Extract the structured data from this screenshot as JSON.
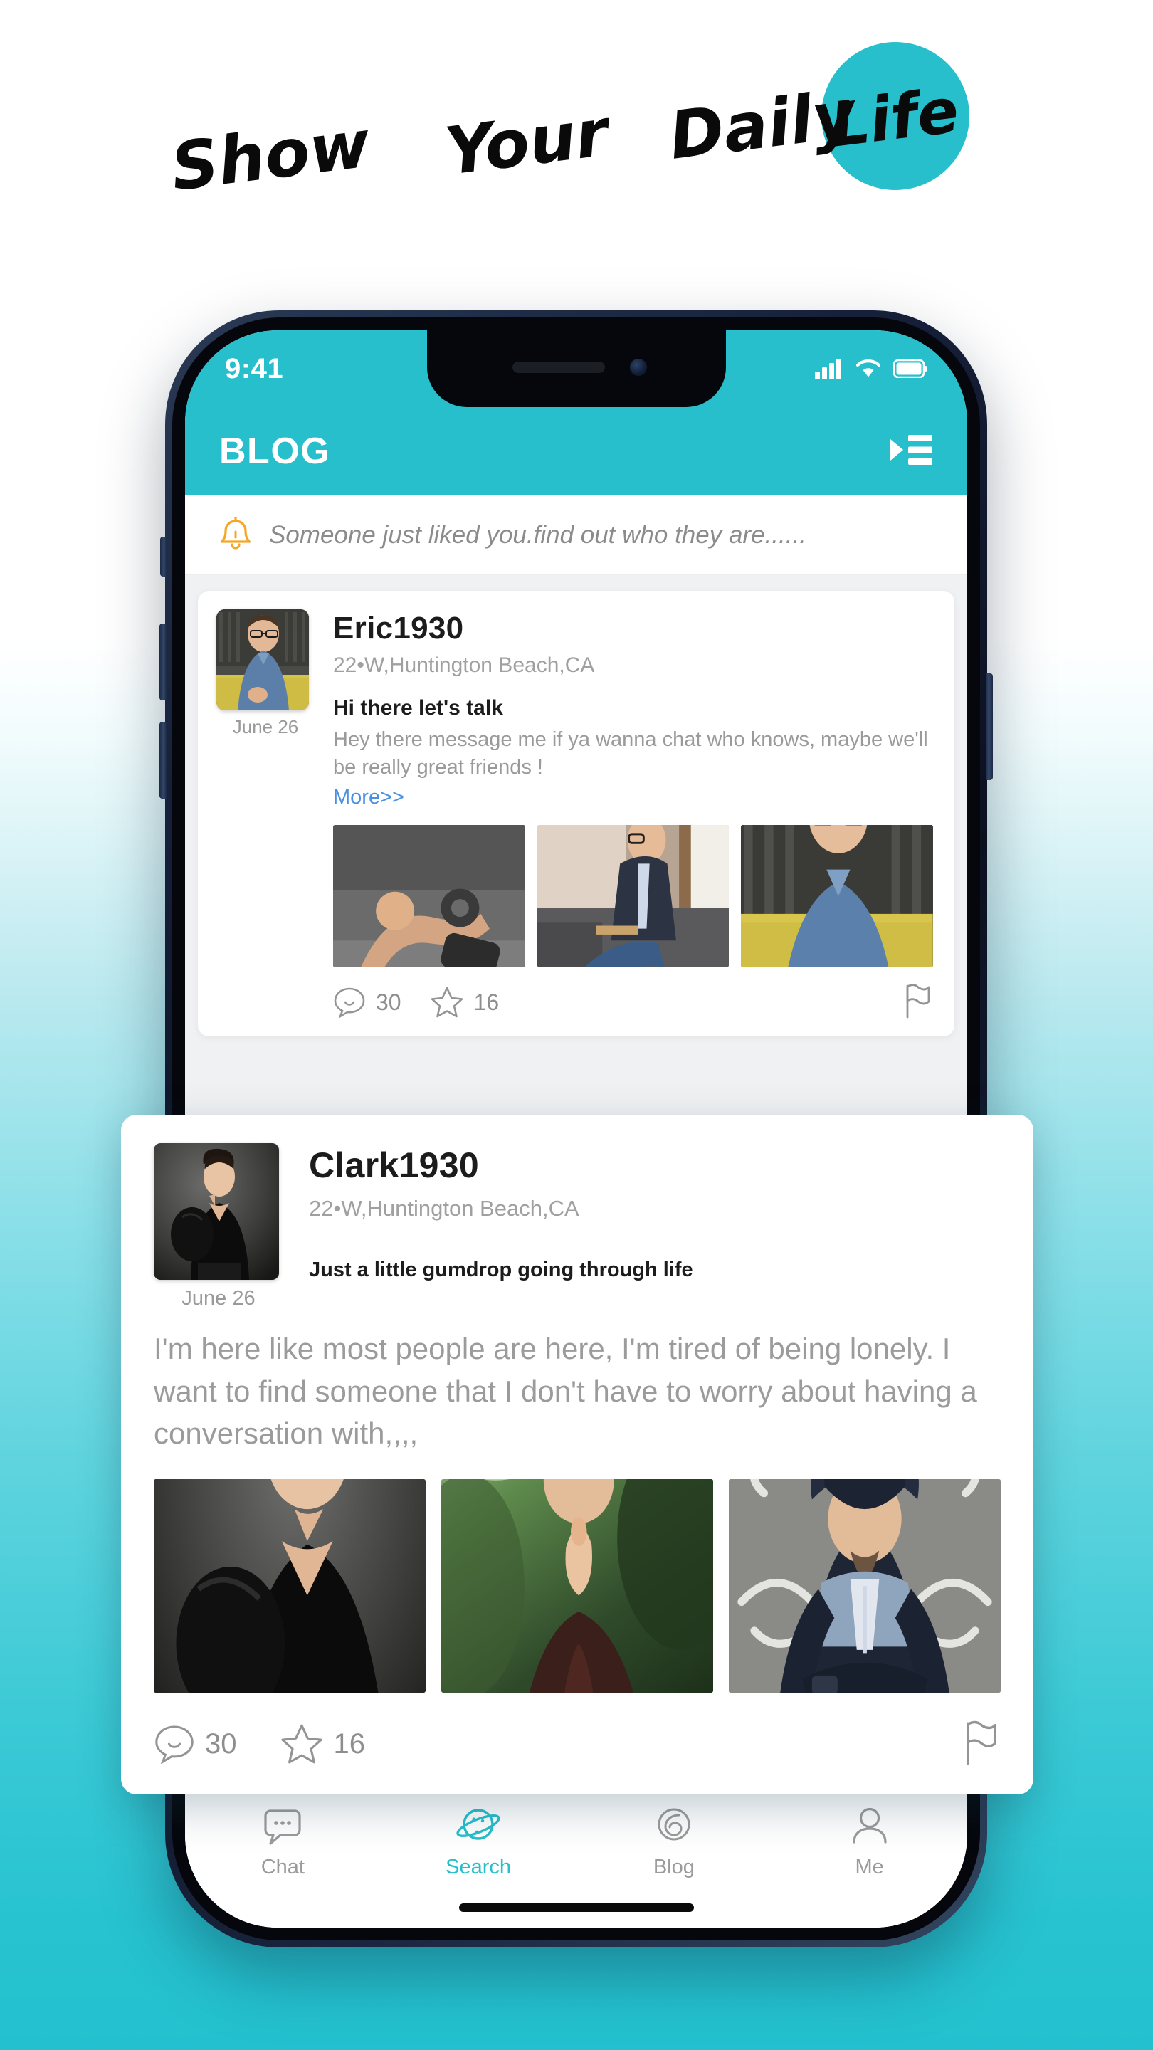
{
  "headline": {
    "words": [
      "Show",
      "Your",
      "Daily"
    ],
    "badge_word": "Life",
    "badge_color": "#27bfcc",
    "text_color": "#0a0a0a"
  },
  "theme": {
    "accent": "#27bfcc",
    "link": "#4a90e2",
    "bell": "#f5a623",
    "muted_text": "#9a9a9a",
    "page_bg_top": "#ffffff",
    "page_bg_bottom": "#23c1cf"
  },
  "phone": {
    "status_bar": {
      "time": "9:41",
      "signal_icon": "cellular-signal-icon",
      "wifi_icon": "wifi-icon",
      "battery_icon": "battery-icon"
    },
    "app_bar": {
      "title": "BLOG",
      "menu_icon": "indent-menu-icon"
    },
    "notification": {
      "icon": "bell-icon",
      "text": "Someone just liked you.find out who they are......"
    },
    "feed": {
      "posts": [
        {
          "username": "Eric1930",
          "meta": "22•W,Huntington Beach,CA",
          "date": "June 26",
          "headline": "Hi there let's talk",
          "body": "Hey there message me if ya wanna chat who knows, maybe we'll be really great friends !",
          "more_label": "More>>",
          "avatar_alt": "man-in-blue-shirt-glasses-avatar",
          "photos": [
            "man-doing-pushups-with-dumbbells",
            "man-in-suit-sitting-on-couch",
            "man-in-blue-shirt-on-yellow-chair"
          ],
          "comments_count": "30",
          "stars_count": "16",
          "flag_icon": "flag-icon",
          "comment_icon": "comment-bubble-icon",
          "star_icon": "star-icon"
        }
      ]
    },
    "bottom_nav": {
      "items": [
        {
          "label": "Chat",
          "icon": "chat-bubble-icon",
          "active": false
        },
        {
          "label": "Search",
          "icon": "planet-search-icon",
          "active": true
        },
        {
          "label": "Blog",
          "icon": "spiral-blog-icon",
          "active": false
        },
        {
          "label": "Me",
          "icon": "person-icon",
          "active": false
        }
      ]
    }
  },
  "overlay_post": {
    "username": "Clark1930",
    "meta": "22•W,Huntington Beach,CA",
    "date": "June 26",
    "headline": "Just a little gumdrop going through life",
    "body": "I'm here like most people are here, I'm tired of being lonely. I want to find someone that I don't have to worry about having a conversation with,,,,",
    "avatar_alt": "young-man-black-sweater-backpack-avatar",
    "photos": [
      "young-man-black-sweater-dark-studio",
      "man-praying-in-green-grass",
      "hooded-man-against-chalkboard-muscle-arms"
    ],
    "comments_count": "30",
    "stars_count": "16",
    "comment_icon": "comment-bubble-icon",
    "star_icon": "star-icon",
    "flag_icon": "flag-icon"
  }
}
